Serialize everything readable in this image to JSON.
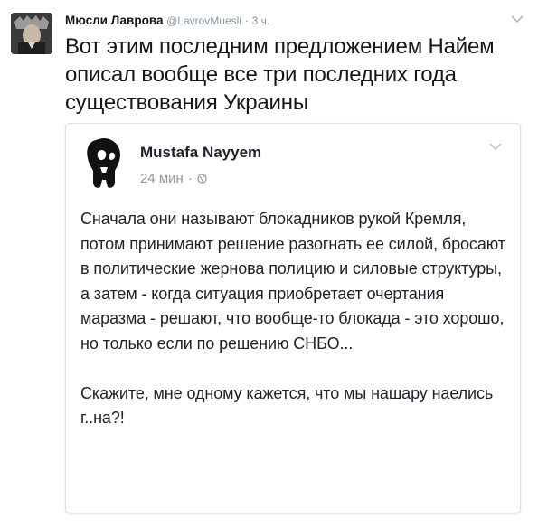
{
  "tweet": {
    "author_name": "Мюсли Лаврова",
    "handle": "@LavrovMuesli",
    "separator": "·",
    "time": "3 ч.",
    "text": "Вот этим последним предложением Найем описал вообще все три последних года существования Украины",
    "caret_icon": "chevron-down-icon"
  },
  "card": {
    "author_name": "Mustafa Nayyem",
    "time": "24 мин",
    "separator": "·",
    "privacy_icon": "globe-icon",
    "caret_icon": "chevron-down-icon",
    "paragraph_1": "Сначала они называют блокадников рукой Кремля, потом принимают решение разогнать ее силой, бросают в политические жернова полицию и силовые структуры, а затем - когда ситуация приобретает очертания маразма - решают, что вообще-то блокада - это хорошо, но только если по решению СНБО...",
    "paragraph_2": "Скажите, мне одному кажется, что мы нашару наелись г..на?!"
  },
  "colors": {
    "name_text": "#14171a",
    "meta_text": "#8899a6",
    "card_border": "#dcdfe3",
    "fb_meta_text": "#90949c"
  }
}
